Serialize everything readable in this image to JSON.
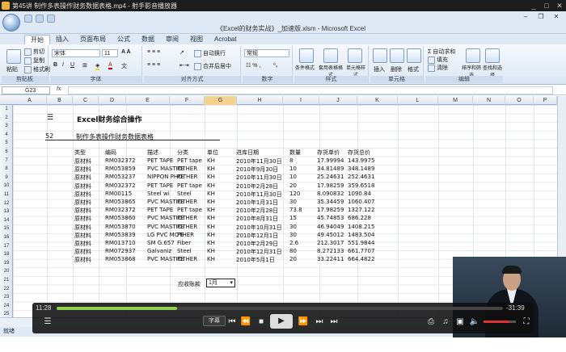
{
  "player": {
    "title": "第45讲  制作多表操作财务数据表格.mp4 - 射手影音播放器",
    "elapsed": "11:28",
    "remaining": "-31:39",
    "progress": 0.27,
    "volume": 0.8,
    "subtitle_button": "字幕",
    "icons": [
      "playlist-icon",
      "prev-icon",
      "rewind-icon",
      "stop-icon",
      "play-icon",
      "forward-icon",
      "next-icon",
      "capture-icon",
      "audio-icon",
      "pip-icon",
      "fullscreen-icon",
      "volume-icon"
    ]
  },
  "excel": {
    "title": "《Excel的财务实战》_加速版.xlsm - Microsoft Excel",
    "tabs": [
      "开始",
      "插入",
      "页面布局",
      "公式",
      "数据",
      "审阅",
      "视图",
      "Acrobat"
    ],
    "active_tab": "开始",
    "ribbon": {
      "clipboard": {
        "label": "剪贴板",
        "paste": "粘贴",
        "cut": "剪切",
        "copy": "复制",
        "format_painter": "格式刷"
      },
      "font": {
        "label": "字体",
        "font_name": "宋体",
        "font_size": "11"
      },
      "alignment": {
        "label": "对齐方式",
        "wrap": "自动换行",
        "merge": "合并后居中"
      },
      "number": {
        "label": "数字",
        "format": "常规"
      },
      "styles": {
        "label": "样式",
        "conditional": "条件格式",
        "table": "套用表格格式",
        "cell": "单元格样式"
      },
      "cells": {
        "label": "单元格",
        "insert": "插入",
        "delete": "删除",
        "format": "格式"
      },
      "editing": {
        "label": "编辑",
        "autosum": "Σ 自动求和",
        "fill": "填充",
        "clear": "清除",
        "sort": "排序和筛选",
        "find": "查找和选择"
      }
    },
    "name_box": "G23",
    "fx": "fx",
    "columns": [
      "A",
      "B",
      "C",
      "D",
      "E",
      "F",
      "G",
      "H",
      "I",
      "J",
      "K",
      "L",
      "M",
      "N",
      "O",
      "P",
      "Q"
    ],
    "rows": [
      "1",
      "2",
      "3",
      "4",
      "5",
      "6",
      "7",
      "8",
      "9",
      "10",
      "11",
      "12",
      "13",
      "14",
      "15",
      "16",
      "17",
      "18",
      "19",
      "20",
      "21",
      "22",
      "23",
      "24",
      "25"
    ],
    "heading_icon": "☰",
    "heading": "Excel财务综合操作",
    "section_no": "52",
    "section_title": "制作多表操作财务数据表格",
    "table_headers": [
      "类型",
      "编码",
      "描述",
      "分类",
      "单位",
      "进库日期",
      "数量",
      "存货单价",
      "存货总价"
    ],
    "table_rows": [
      [
        "原材料",
        "RM032372",
        "PET TAPE",
        "PET tape",
        "KH",
        "2010年11月30日",
        "8",
        "17.99994",
        "143.9975"
      ],
      [
        "原材料",
        "RM053859",
        "PVC MASTIOTHER",
        "PE",
        "KH",
        "2010年9月30日",
        "10",
        "34.81489",
        "348.1489"
      ],
      [
        "原材料",
        "RM053237",
        "NIPPON PHOTHER",
        "PE",
        "KH",
        "2010年11月30日",
        "10",
        "25.24631",
        "252.4631"
      ],
      [
        "原材料",
        "RM032372",
        "PET TAPE",
        "PET tape",
        "KH",
        "2010年2月28日",
        "20",
        "17.98259",
        "359.6518"
      ],
      [
        "原材料",
        "RM00115",
        "Steel wi",
        "Steel",
        "KH",
        "2010年11月30日",
        "120",
        "8.090832",
        "1090.84"
      ],
      [
        "原材料",
        "RM053865",
        "PVC MASTIOTHER",
        "PE",
        "KH",
        "2010年1月31日",
        "30",
        "35.34459",
        "1060.407"
      ],
      [
        "原材料",
        "RM032372",
        "PET TAPE",
        "PET tape",
        "KH",
        "2010年2月28日",
        "73.8",
        "17.98259",
        "1327.122"
      ],
      [
        "原材料",
        "RM053860",
        "PVC MASTIOTHER",
        "PE",
        "KH",
        "2010年8月31日",
        "15",
        "45.74853",
        "686.228"
      ],
      [
        "原材料",
        "RM053870",
        "PVC MASTIOTHER",
        "PE",
        "KH",
        "2010年10月31日",
        "30",
        "46.94049",
        "1408.215"
      ],
      [
        "原材料",
        "RM053839",
        "LG PVC MOTHER",
        "PE",
        "KH",
        "2010年12月1日",
        "30",
        "49.45012",
        "1483.504"
      ],
      [
        "原材料",
        "RM013710",
        "SM G.657",
        "Fiber",
        "KH",
        "2010年2月29日",
        "2.6",
        "212.3017",
        "551.9844"
      ],
      [
        "原材料",
        "RM072937",
        "Galvaniz",
        "Steel",
        "KH",
        "2010年12月31日",
        "80",
        "8.272133",
        "661.7707"
      ],
      [
        "原材料",
        "RM053868",
        "PVC MASTIOTHER",
        "PE",
        "KH",
        "2010年5月1日",
        "20",
        "33.22411",
        "664.4822"
      ]
    ],
    "receivable_label": "应收账款",
    "receivable_value": "1月",
    "status": "就绪"
  }
}
